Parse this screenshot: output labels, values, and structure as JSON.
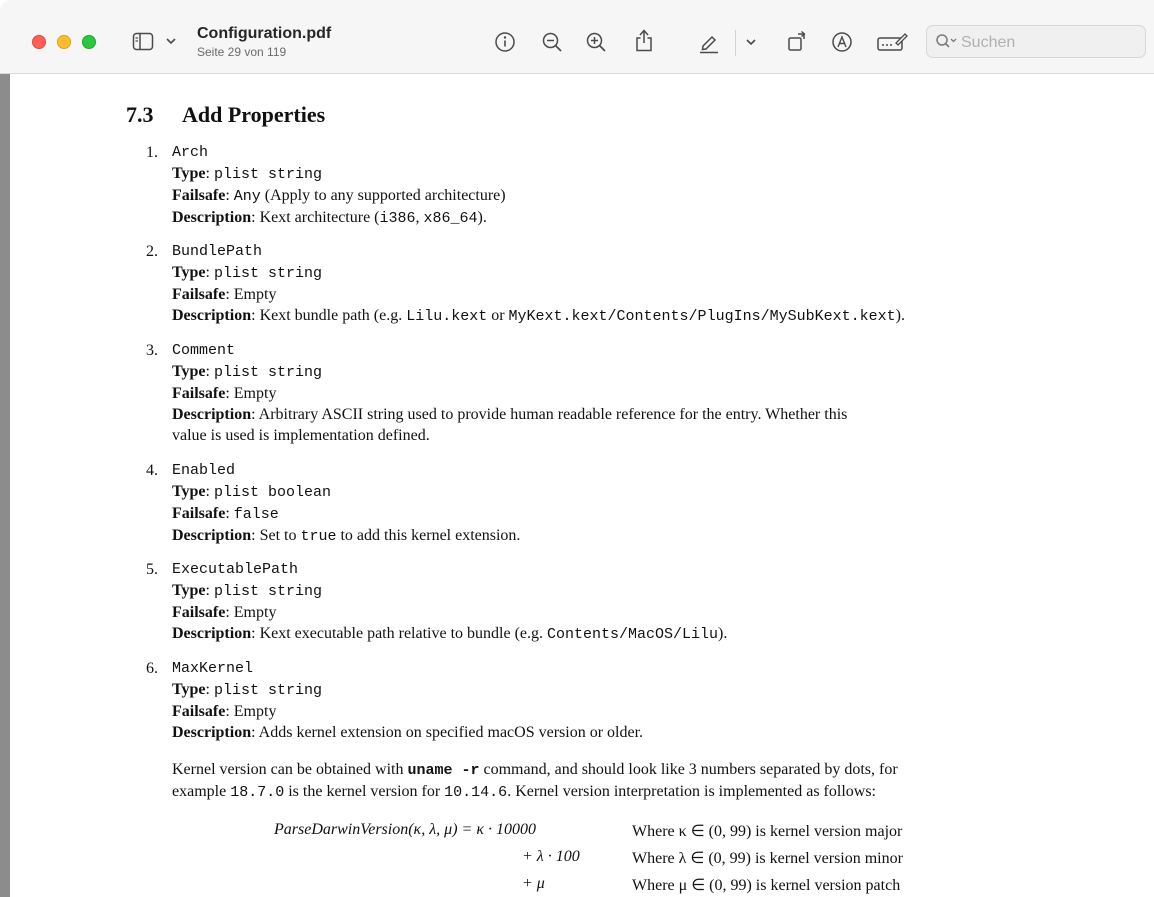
{
  "toolbar": {
    "title": "Configuration.pdf",
    "subtitle": "Seite 29 von 119",
    "search_placeholder": "Suchen",
    "icons": [
      "sidebar-icon",
      "chevron-down-icon",
      "info-icon",
      "zoom-out-icon",
      "zoom-in-icon",
      "share-icon",
      "highlight-pen-icon",
      "chevron-down-icon",
      "rotate-icon",
      "markup-icon",
      "form-fill-icon",
      "search-icon"
    ]
  },
  "document": {
    "section_number": "7.3",
    "section_title": "Add Properties",
    "type_label": "Type",
    "failsafe_label": "Failsafe",
    "description_label": "Description",
    "items": [
      {
        "num": "1.",
        "key": "Arch",
        "type": "plist string",
        "failsafe_code": "Any",
        "failsafe_text": " (Apply to any supported architecture)",
        "desc_pre": "Kext architecture (",
        "desc_code1": "i386",
        "desc_mid": ", ",
        "desc_code2": "x86_64",
        "desc_post": ")."
      },
      {
        "num": "2.",
        "key": "BundlePath",
        "type": "plist string",
        "failsafe_text": "Empty",
        "desc_pre": "Kext bundle path (e.g. ",
        "desc_code1": "Lilu.kext",
        "desc_mid": " or ",
        "desc_code2": "MyKext.kext/Contents/PlugIns/MySubKext.kext",
        "desc_post": ")."
      },
      {
        "num": "3.",
        "key": "Comment",
        "type": "plist string",
        "failsafe_text": "Empty",
        "desc_line1": "Arbitrary ASCII string used to provide human readable reference for the entry. Whether this",
        "desc_line2": "value is used is implementation defined."
      },
      {
        "num": "4.",
        "key": "Enabled",
        "type": "plist boolean",
        "failsafe_code": "false",
        "desc_pre": "Set to ",
        "desc_code1": "true",
        "desc_post": " to add this kernel extension."
      },
      {
        "num": "5.",
        "key": "ExecutablePath",
        "type": "plist string",
        "failsafe_text": "Empty",
        "desc_pre": "Kext executable path relative to bundle (e.g. ",
        "desc_code1": "Contents/MacOS/Lilu",
        "desc_post": ")."
      },
      {
        "num": "6.",
        "key": "MaxKernel",
        "type": "plist string",
        "failsafe_text": "Empty",
        "desc_text": "Adds kernel extension on specified macOS version or older."
      }
    ],
    "paragraph": {
      "p1_pre": "Kernel version can be obtained with ",
      "p1_code": "uname -r",
      "p1_post": " command, and should look like 3 numbers separated by dots, for",
      "p2_pre": "example ",
      "p2_code1": "18.7.0",
      "p2_mid": " is the kernel version for ",
      "p2_code2": "10.14.6",
      "p2_post": ". Kernel version interpretation is implemented as follows:"
    },
    "equation": {
      "lhs": "ParseDarwinVersion(κ, λ, μ) = κ · 10000",
      "row2": "+ λ · 100",
      "row3": "+ μ",
      "where1": "Where κ ∈ (0, 99) is kernel version major",
      "where2": "Where λ ∈ (0, 99) is kernel version minor",
      "where3": "Where μ ∈ (0, 99) is kernel version patch"
    }
  }
}
